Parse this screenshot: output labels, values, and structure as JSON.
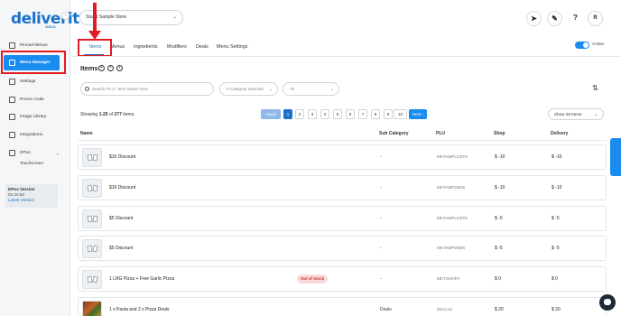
{
  "brand": {
    "logo": "deliverit",
    "sub": "GOLD"
  },
  "sidebar": {
    "items": [
      {
        "label": "Pinned Menus"
      },
      {
        "label": "Menu Manager"
      },
      {
        "label": "Settings"
      },
      {
        "label": "Promo Code"
      },
      {
        "label": "Image Library"
      },
      {
        "label": "Integrations"
      },
      {
        "label": "DPos"
      }
    ],
    "sub_item": "Touchscreen",
    "version": {
      "title": "DPos Version",
      "number": "02.20.55",
      "link": "Latest Version"
    }
  },
  "header": {
    "store": "Stuart Sample Store",
    "icons": [
      "rocket-icon",
      "feather-icon",
      "help-icon",
      "user-avatar"
    ],
    "avatar_letter": "R",
    "help_glyph": "?"
  },
  "tabs": [
    {
      "label": "Items",
      "active": true
    },
    {
      "label": "Menus"
    },
    {
      "label": "Ingredients"
    },
    {
      "label": "Modifiers"
    },
    {
      "label": "Deals"
    },
    {
      "label": "Menu Settings"
    }
  ],
  "active_toggle": {
    "label": "Active",
    "on": true
  },
  "items_title": "Items",
  "filters": {
    "search_placeholder": "Search PLU / Item Name here",
    "category": "0 Category selected",
    "type": "All"
  },
  "pagination": {
    "showing_prefix": "Showing ",
    "range": "1-25",
    "of": " of ",
    "total": "277",
    "suffix": " items.",
    "prev": "‹ Back",
    "pages": [
      "1",
      "2",
      "3",
      "4",
      "5",
      "6",
      "7",
      "8",
      "9",
      "10"
    ],
    "current": "1",
    "next": "Next ›",
    "page_size": "Show 25 Items"
  },
  "table": {
    "columns": [
      "Name",
      "Sub Category",
      "PLU",
      "Shop",
      "Delivery"
    ],
    "rows": [
      {
        "name": "$10 Discount",
        "sub": "-",
        "plu": "MKTAMPLOST6",
        "shop": "$ -10",
        "delivery": "$ -10",
        "badge": ""
      },
      {
        "name": "$10 Discount",
        "sub": "-",
        "plu": "MKTAMP2ND6",
        "shop": "$ -10",
        "delivery": "$ -10",
        "badge": ""
      },
      {
        "name": "$5 Discount",
        "sub": "-",
        "plu": "MKTAMPLOST5",
        "shop": "$ -5",
        "delivery": "$ -5",
        "badge": ""
      },
      {
        "name": "$5 Discount",
        "sub": "-",
        "plu": "MKTAMP2ND5",
        "shop": "$ -5",
        "delivery": "$ -5",
        "badge": ""
      },
      {
        "name": "1 LRG Pizza + Free Garlic Pizza",
        "sub": "-",
        "plu": "MKTSHOPA",
        "shop": "$ 0",
        "delivery": "$ 0",
        "badge": "Out of Stock"
      },
      {
        "name": "1 x Pasta and 2 x Pizza Deals",
        "sub": "Deals",
        "plu": "DEAL10",
        "shop": "$ 20",
        "delivery": "$ 20",
        "badge": ""
      }
    ]
  },
  "feedback": "Feedback"
}
